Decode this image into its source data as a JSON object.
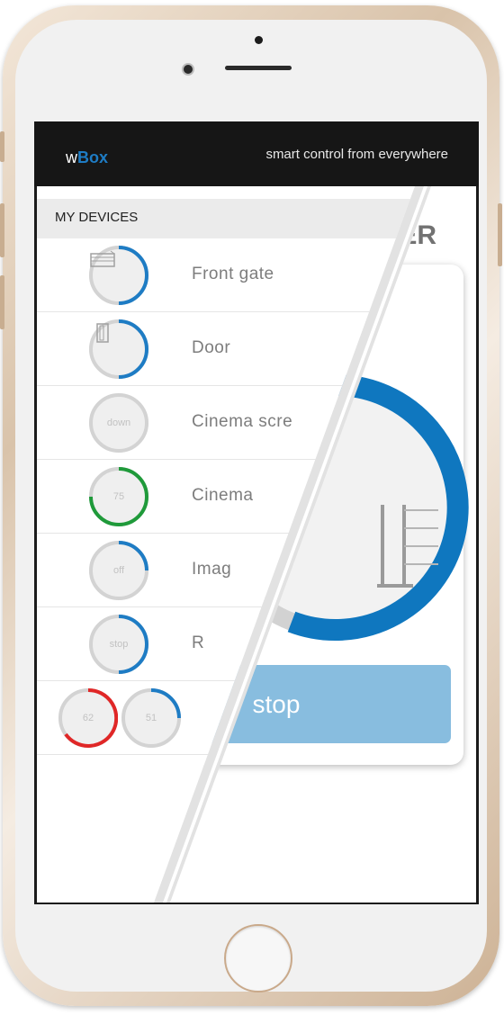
{
  "app": {
    "logo_prefix": "w",
    "logo_brand": "Box",
    "tagline": "smart control from everywhere",
    "accent": "#1e7cc4"
  },
  "device_list": {
    "header": "MY DEVICES",
    "rows": [
      {
        "name": "Front gate",
        "icon": "gate-icon",
        "ring_color": "#1e7cc4",
        "level": 0.5
      },
      {
        "name": "Door",
        "icon": "door-icon",
        "ring_color": "#1e7cc4",
        "level": 0.5
      },
      {
        "name": "Cinema scre",
        "status": "down",
        "ring_color": "#cccccc",
        "level": 0
      },
      {
        "name": "Cinema",
        "status": "75",
        "ring_color": "#1f9a3a",
        "level": 0.75
      },
      {
        "name": "Imag",
        "status": "off",
        "ring_color": "#1e7cc4",
        "level": 0.25
      },
      {
        "name": "R",
        "status": "stop",
        "ring_color": "#1e7cc4",
        "level": 0.5
      },
      {
        "name": "",
        "status_a": "62",
        "status_b": "51",
        "ring_color_a": "#e02727",
        "ring_color_b": "#1e7cc4",
        "level_a": 0.62,
        "level_b": 0.25
      }
    ]
  },
  "detail": {
    "title": "TER",
    "position_level": 0.6,
    "stop_label": "stop",
    "button_color": "#88bddf"
  }
}
